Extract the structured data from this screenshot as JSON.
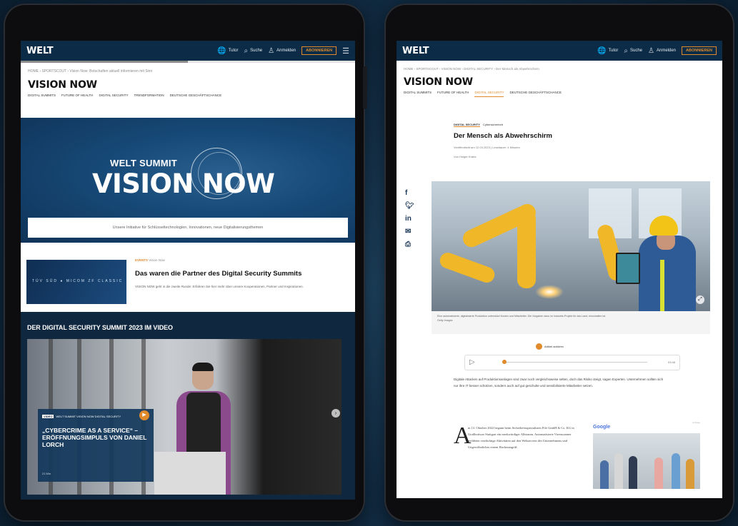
{
  "left": {
    "header": {
      "logo": "WELT",
      "items": [
        {
          "icon": "globe-icon",
          "label": "Tutor"
        },
        {
          "icon": "search-icon",
          "label": "Suche"
        },
        {
          "icon": "user-icon",
          "label": "Anmelden"
        }
      ],
      "subscribe": "ABONNIEREN",
      "menu_icon": "menu-icon"
    },
    "reading_progress": 0.5,
    "breadcrumb": "HOME › SPORTSCOUT › Vision Now: Botschaften aktuell informieren mit Sinn",
    "brand": "VISION NOW",
    "nav": [
      "DIGITAL SUMMITS",
      "FUTURE OF HEALTH",
      "DIGITAL SECURITY",
      "TRENDFORMATION",
      "DEUTSCHE GESCHÄFTSCHANCE"
    ],
    "hero": {
      "small": "WELT SUMMIT",
      "big": "VISION NOW"
    },
    "tagline": "Unsere Initiative für Schlüsseltechnologien, Innovationen, neue Digitalisierungsthemen",
    "partners": {
      "logos": "TÜV SÜD   ● MICOM   ZF CLASSIC",
      "category": "EVENTS",
      "meta": "Vision Now",
      "title": "Das waren die Partner des Digital Security Summits",
      "desc": "VISION NOW geht in die zweite Runde: Erfahren Sie hier mehr über unsere Kooperationen, Partner und Inspirationen."
    },
    "video_section": {
      "heading": "DER DIGITAL SECURITY SUMMIT 2023 IM VIDEO",
      "card_tag_label": "VIDEO",
      "card_tag_text": "WELT SUMMIT VISION NOW DIGITAL SECURITY",
      "card_title": "„CYBERCRIME AS A SERVICE“ – ERÖFFNUNGSIMPULS VON DANIEL LORCH",
      "card_duration": "21 Min"
    }
  },
  "right": {
    "header": {
      "logo": "WELT",
      "items": [
        {
          "icon": "globe-icon",
          "label": "Tutor"
        },
        {
          "icon": "search-icon",
          "label": "Suche"
        },
        {
          "icon": "user-icon",
          "label": "Anmelden"
        }
      ],
      "subscribe": "ABONNIEREN"
    },
    "breadcrumb": "HOME › SPORTSCOUT › VISION NOW › DIGITAL SECURITY › Der Mensch als Abwehrschirm",
    "brand": "VISION NOW",
    "nav": [
      "DIGITAL SUMMITS",
      "FUTURE OF HEALTH",
      "DIGITAL SECURITY",
      "DEUTSCHE GESCHÄFTSCHANCE"
    ],
    "nav_active": 2,
    "article": {
      "category": "DIGITAL SECURITY",
      "subcategory": "Cybersicherheit",
      "headline": "Der Mensch als Abwehrschirm",
      "published": "Veröffentlicht am 12.03.2023 | Lesedauer: 4 Minuten",
      "author": "Von Holger Krahe",
      "caption": "Eine automatisierte, digitalisierte Produktion unterstützt Kosten und Mitarbeiter. Die Vorgaben dazu im Industrie-Projekt für das Land, einzuhalten ist.",
      "caption_credit": "Getty Images",
      "audio_label": "Artikel anhören",
      "audio_time": "03:48",
      "lead": "Digitale Attacken auf Produktionsanlagen sind zwar noch vergleichsweise selten, doch das Risiko steigt, sagen Experten. Unternehmen sollten sich nur ihre IT besser schützen, sondern auch auf gut geschulte und sensibilisierte Mitarbeiter setzen.",
      "dropcap": "A",
      "body": "m 13. Oktober 2022 begann beim Sicherheitsspezialisten Fife GmbH & Co. KG in Großbottwar Stuttgart ein merkwürdiger Albtraum. Automatisierte Virenscanner meldeten verdächtige Aktivitäten auf den Webservern des Unternehmens und Ungewöhnliches einem Hackerangriff.",
      "ad_label": "Anzeige",
      "ad_brand": "Google"
    },
    "share_icons": [
      "facebook-icon",
      "twitter-icon",
      "linkedin-icon",
      "mail-icon",
      "print-icon"
    ]
  }
}
